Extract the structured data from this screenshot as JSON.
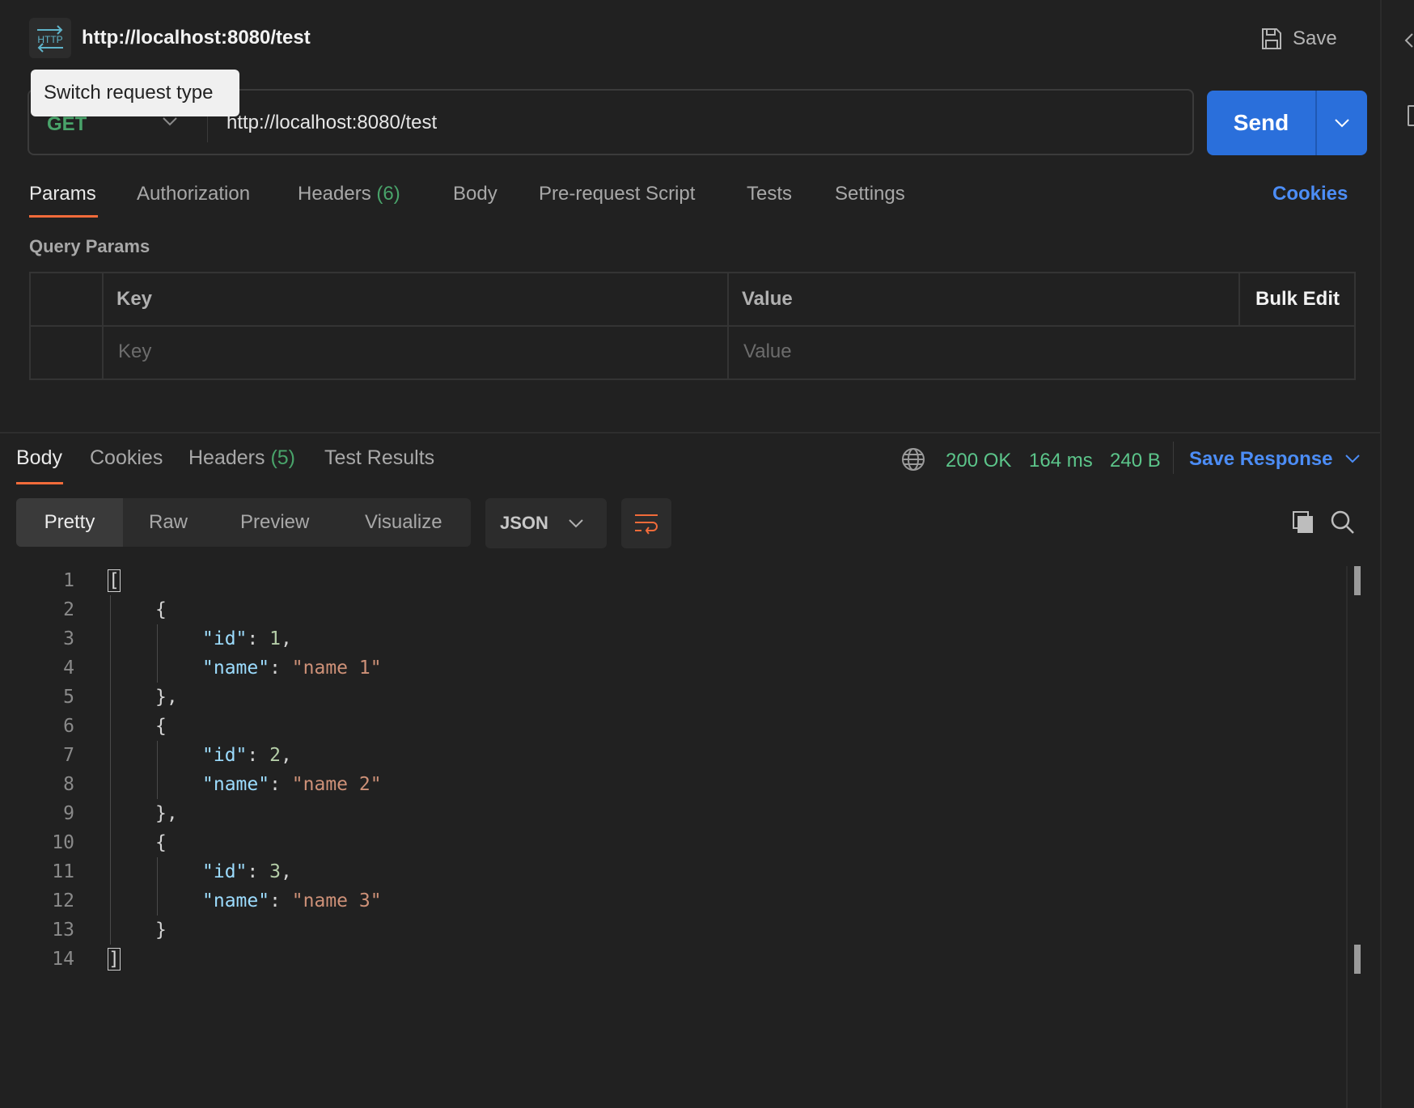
{
  "header": {
    "icon": "http-swap-icon",
    "request_title": "http://localhost:8080/test",
    "save_label": "Save",
    "tooltip": "Switch request type"
  },
  "request": {
    "method": "GET",
    "url": "http://localhost:8080/test",
    "send_label": "Send",
    "method_color": "#49a36a",
    "send_color": "#2a6fdb"
  },
  "request_tabs": {
    "params": "Params",
    "authorization": "Authorization",
    "headers": "Headers",
    "headers_count": "(6)",
    "body": "Body",
    "pre_request": "Pre-request Script",
    "tests": "Tests",
    "settings": "Settings",
    "cookies": "Cookies"
  },
  "query_params": {
    "label": "Query Params",
    "col_key": "Key",
    "col_value": "Value",
    "bulk_edit": "Bulk Edit",
    "key_placeholder": "Key",
    "value_placeholder": "Value"
  },
  "response": {
    "tabs": {
      "body": "Body",
      "cookies": "Cookies",
      "headers": "Headers",
      "headers_count": "(5)",
      "test_results": "Test Results"
    },
    "status": "200 OK",
    "time": "164 ms",
    "size": "240 B",
    "save_response": "Save Response",
    "status_color": "#5cc58a",
    "views": {
      "pretty": "Pretty",
      "raw": "Raw",
      "preview": "Preview",
      "visualize": "Visualize"
    },
    "format": "JSON",
    "code": [
      {
        "num": "1",
        "indent": 0,
        "tokens": [
          {
            "t": "[",
            "c": "p"
          }
        ],
        "box": true
      },
      {
        "num": "2",
        "indent": 1,
        "tokens": [
          {
            "t": "{",
            "c": "p"
          }
        ]
      },
      {
        "num": "3",
        "indent": 2,
        "tokens": [
          {
            "t": "\"id\"",
            "c": "k"
          },
          {
            "t": ": ",
            "c": "p"
          },
          {
            "t": "1",
            "c": "n"
          },
          {
            "t": ",",
            "c": "p"
          }
        ]
      },
      {
        "num": "4",
        "indent": 2,
        "tokens": [
          {
            "t": "\"name\"",
            "c": "k"
          },
          {
            "t": ": ",
            "c": "p"
          },
          {
            "t": "\"name 1\"",
            "c": "s"
          }
        ]
      },
      {
        "num": "5",
        "indent": 1,
        "tokens": [
          {
            "t": "},",
            "c": "p"
          }
        ]
      },
      {
        "num": "6",
        "indent": 1,
        "tokens": [
          {
            "t": "{",
            "c": "p"
          }
        ]
      },
      {
        "num": "7",
        "indent": 2,
        "tokens": [
          {
            "t": "\"id\"",
            "c": "k"
          },
          {
            "t": ": ",
            "c": "p"
          },
          {
            "t": "2",
            "c": "n"
          },
          {
            "t": ",",
            "c": "p"
          }
        ]
      },
      {
        "num": "8",
        "indent": 2,
        "tokens": [
          {
            "t": "\"name\"",
            "c": "k"
          },
          {
            "t": ": ",
            "c": "p"
          },
          {
            "t": "\"name 2\"",
            "c": "s"
          }
        ]
      },
      {
        "num": "9",
        "indent": 1,
        "tokens": [
          {
            "t": "},",
            "c": "p"
          }
        ]
      },
      {
        "num": "10",
        "indent": 1,
        "tokens": [
          {
            "t": "{",
            "c": "p"
          }
        ]
      },
      {
        "num": "11",
        "indent": 2,
        "tokens": [
          {
            "t": "\"id\"",
            "c": "k"
          },
          {
            "t": ": ",
            "c": "p"
          },
          {
            "t": "3",
            "c": "n"
          },
          {
            "t": ",",
            "c": "p"
          }
        ]
      },
      {
        "num": "12",
        "indent": 2,
        "tokens": [
          {
            "t": "\"name\"",
            "c": "k"
          },
          {
            "t": ": ",
            "c": "p"
          },
          {
            "t": "\"name 3\"",
            "c": "s"
          }
        ]
      },
      {
        "num": "13",
        "indent": 1,
        "tokens": [
          {
            "t": "}",
            "c": "p"
          }
        ]
      },
      {
        "num": "14",
        "indent": 0,
        "tokens": [
          {
            "t": "]",
            "c": "p"
          }
        ],
        "box": true
      }
    ]
  }
}
